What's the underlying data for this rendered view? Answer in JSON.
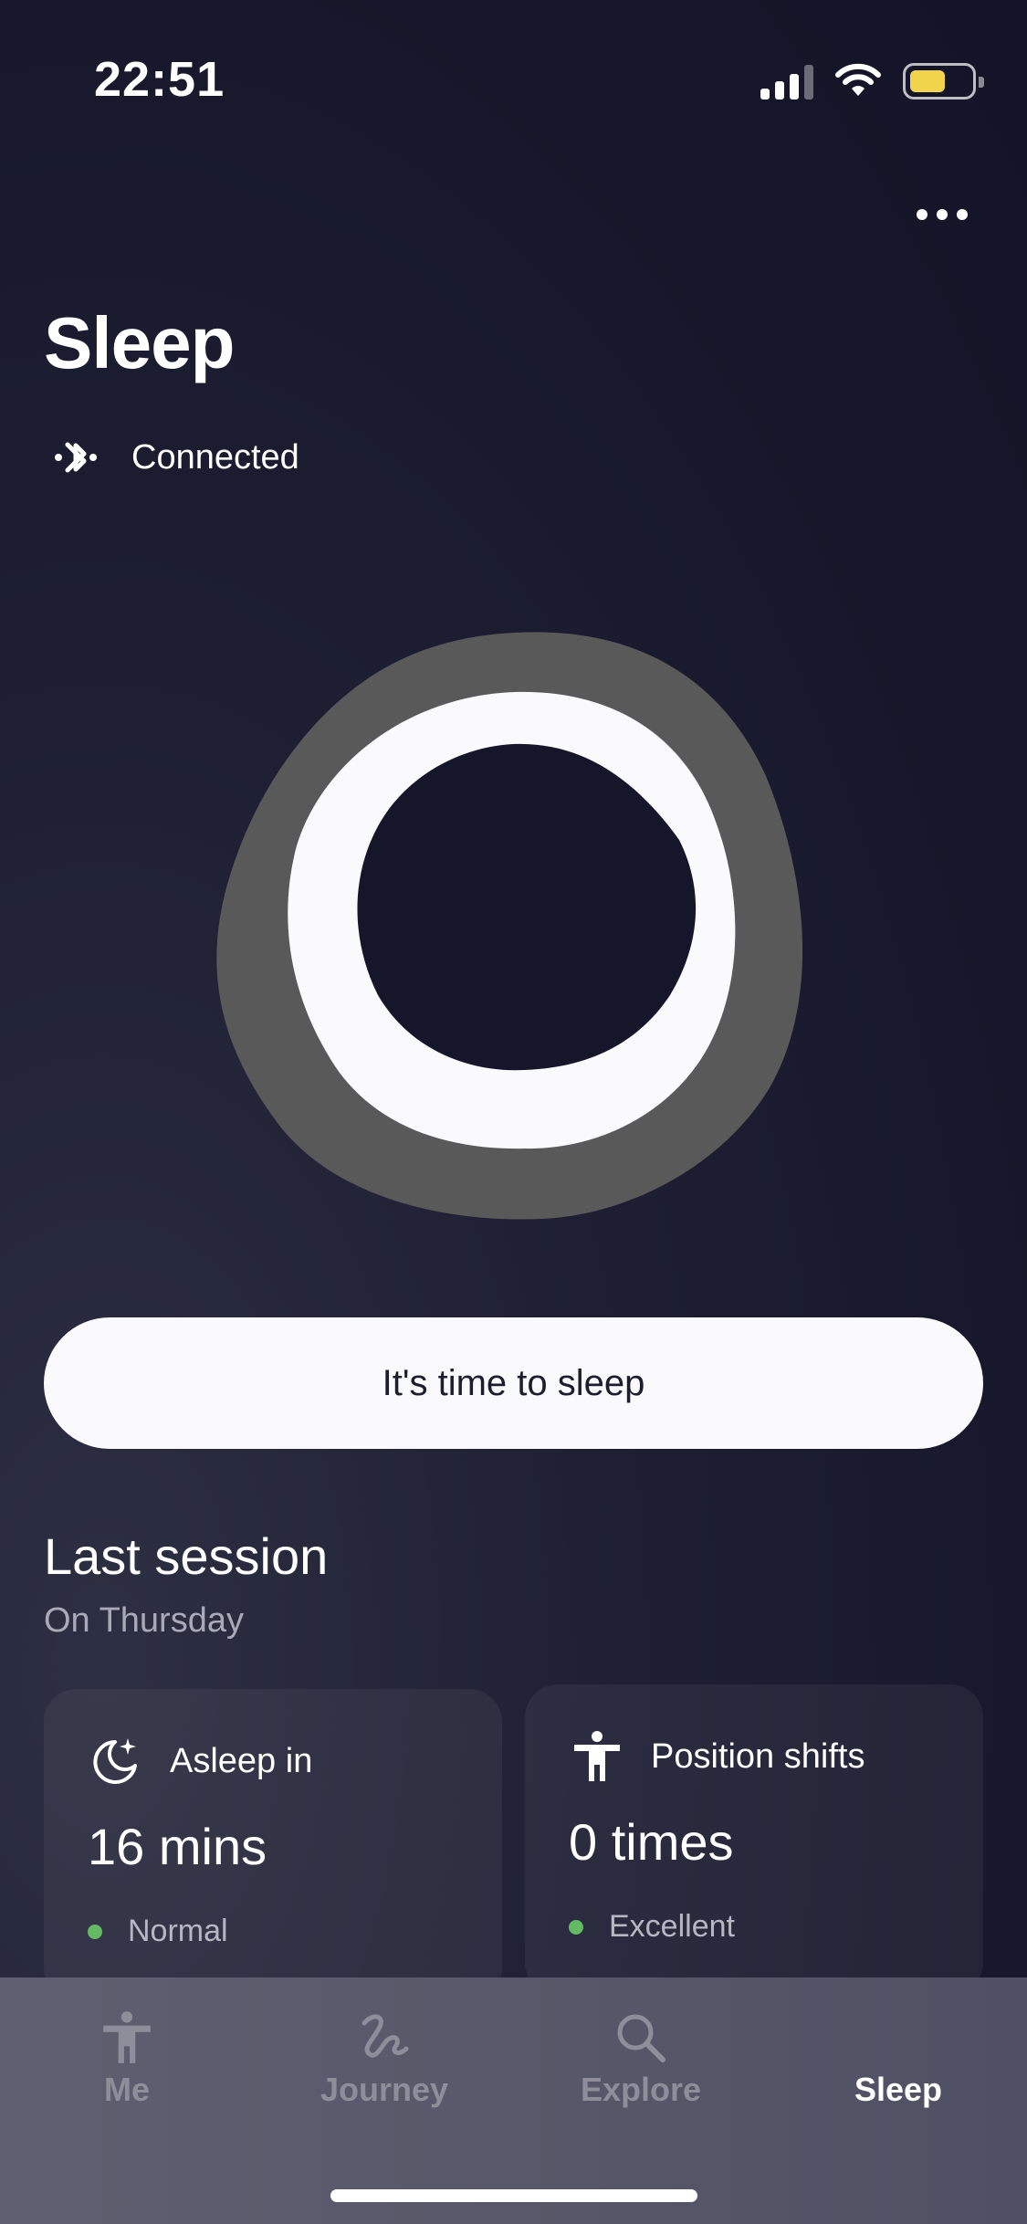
{
  "status_bar": {
    "time": "22:51",
    "battery_level": 0.6,
    "battery_color": "#f2d34c",
    "icons": [
      "cellular-signal-icon",
      "wifi-icon",
      "battery-icon"
    ]
  },
  "header": {
    "title": "Sleep",
    "more_icon": "more-horizontal-icon"
  },
  "connection": {
    "icon": "bluetooth-icon",
    "label": "Connected"
  },
  "primary_action": {
    "label": "It's time to sleep"
  },
  "last_session": {
    "title": "Last session",
    "subtitle": "On Thursday",
    "cards": [
      {
        "icon": "moon-stars-icon",
        "label": "Asleep in",
        "value": "16 mins",
        "status": "Normal",
        "status_color": "#64b964"
      },
      {
        "icon": "person-icon",
        "label": "Position shifts",
        "value": "0 times",
        "status": "Excellent",
        "status_color": "#64b964"
      }
    ]
  },
  "tab_bar": {
    "tabs": [
      {
        "label": "Me",
        "icon": "person-icon",
        "active": false
      },
      {
        "label": "Journey",
        "icon": "journey-squiggle-icon",
        "active": false
      },
      {
        "label": "Explore",
        "icon": "search-icon",
        "active": false
      },
      {
        "label": "Sleep",
        "icon": "moon-icon",
        "active": true
      }
    ]
  },
  "colors": {
    "background": "#16172a",
    "accent_white": "#fafafd",
    "ring_gray": "#5a5a5a",
    "status_good": "#64b964"
  }
}
